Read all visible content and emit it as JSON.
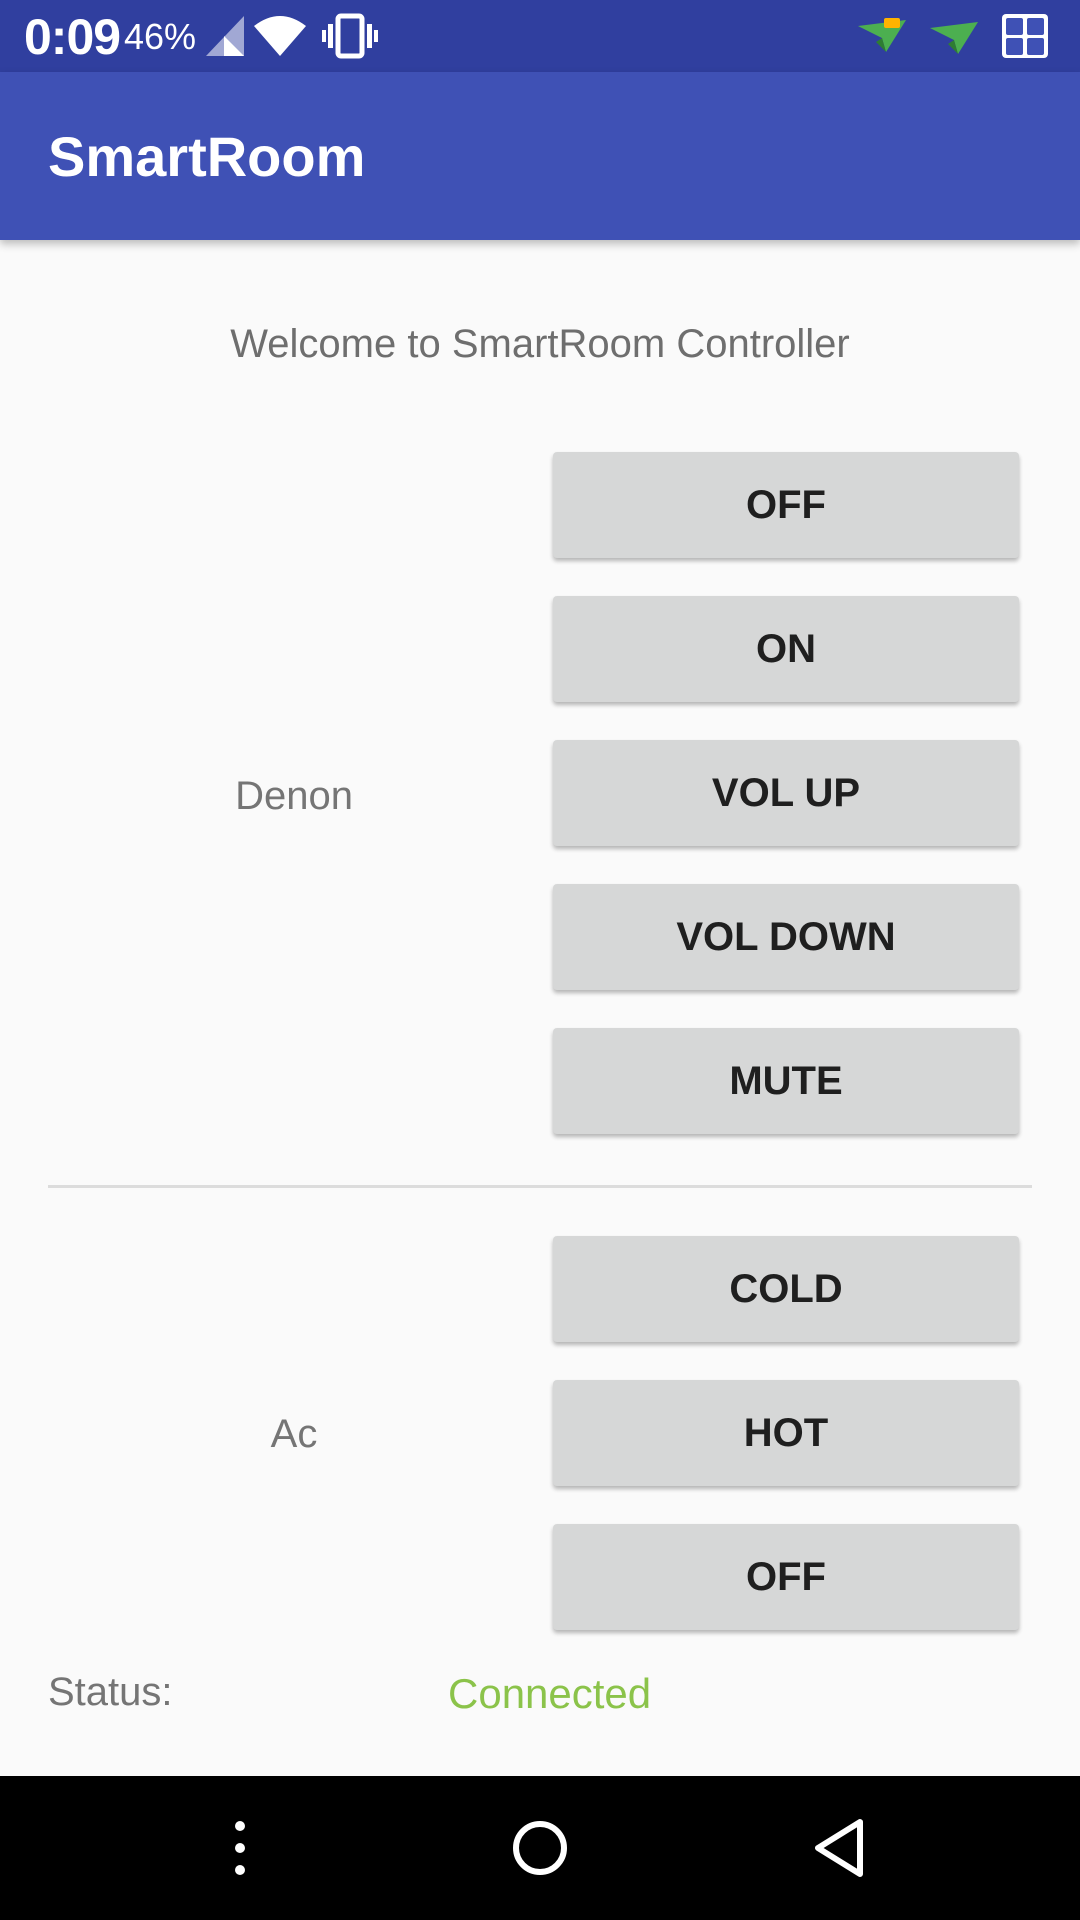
{
  "status_bar": {
    "time": "0:09",
    "battery": "46%",
    "icons": [
      "signal-icon",
      "wifi-icon",
      "vibrate-icon",
      "notification-icon",
      "notification-icon",
      "app-icon"
    ]
  },
  "app_bar": {
    "title": "SmartRoom"
  },
  "main": {
    "welcome": "Welcome to SmartRoom Controller",
    "denon": {
      "label": "Denon",
      "buttons": [
        "OFF",
        "ON",
        "VOL UP",
        "VOL DOWN",
        "MUTE"
      ]
    },
    "ac": {
      "label": "Ac",
      "buttons": [
        "COLD",
        "HOT",
        "OFF"
      ]
    },
    "status": {
      "label": "Status:",
      "value": "Connected"
    }
  },
  "colors": {
    "status_bar": "#303f9f",
    "app_bar": "#3f51b5",
    "connected": "#8bc34a"
  },
  "nav_bar": {
    "icons": [
      "more-vertical-icon",
      "home-icon",
      "back-icon"
    ]
  }
}
